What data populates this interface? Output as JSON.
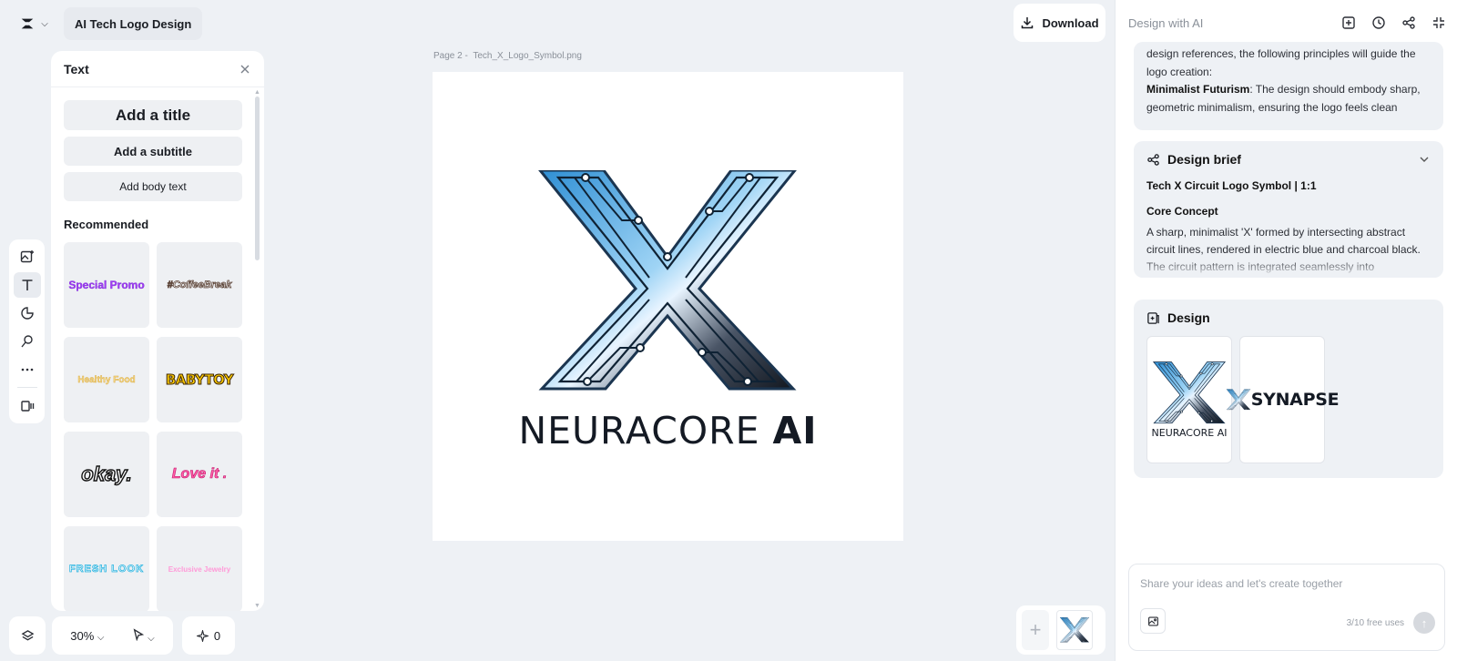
{
  "app": {
    "doc_title": "AI Tech Logo Design"
  },
  "rail": {
    "items": [
      "image-upload",
      "text",
      "elements",
      "brand",
      "more",
      "video"
    ]
  },
  "text_panel": {
    "title": "Text",
    "add_title": "Add a title",
    "add_subtitle": "Add a subtitle",
    "add_body": "Add body text",
    "recommended_label": "Recommended",
    "styles": [
      "Special Promo",
      "#CoffeeBreak",
      "Healthy Food",
      "BABYTOY",
      "okay.",
      "Love it .",
      "FRESH LOOK",
      "Exclusive Jewelry"
    ]
  },
  "bottom_bar": {
    "zoom": "30%",
    "credits": "0"
  },
  "canvas": {
    "page_label": "Page 2 -",
    "file_name": "Tech_X_Logo_Symbol.png",
    "wordmark_light": "NEURACORE",
    "wordmark_bold": "AI"
  },
  "toolbar": {
    "download_label": "Download"
  },
  "ai_panel": {
    "header_label": "Design with AI",
    "intro_text_1": "design references, the following principles will guide the logo creation:",
    "intro_bold": "Minimalist Futurism",
    "intro_text_2": ": The design should embody sharp, geometric minimalism, ensuring the logo feels clean",
    "brief_header": "Design brief",
    "brief_title": "Tech X Circuit Logo Symbol | 1:1",
    "brief_sub": "Core Concept",
    "brief_text": "A sharp, minimalist 'X' formed by intersecting abstract circuit lines, rendered in electric blue and charcoal black. The circuit pattern is integrated seamlessly into",
    "design_header": "Design",
    "thumb_1_word": "NEURACORE AI",
    "thumb_2_word": "SYNAPSE",
    "input_placeholder": "Share your ideas and let's create together",
    "free_uses": "3/10 free uses"
  },
  "colors": {
    "accent_blue": "#2f7fc0",
    "charcoal": "#1d222b",
    "panel_bg": "#eef1f5"
  }
}
